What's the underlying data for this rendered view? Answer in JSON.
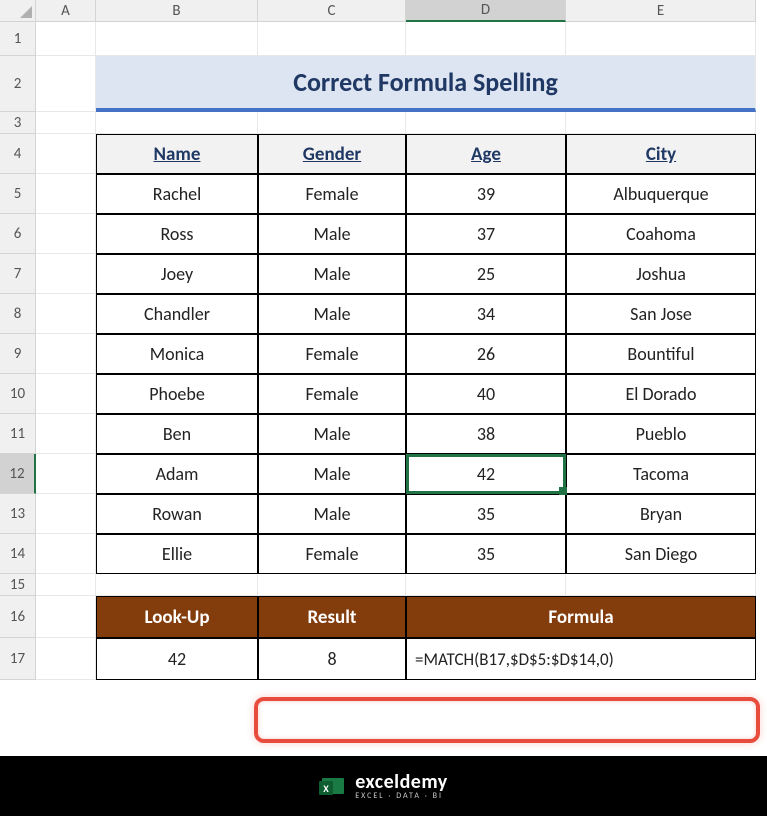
{
  "columns": [
    "A",
    "B",
    "C",
    "D",
    "E"
  ],
  "rows": [
    "1",
    "2",
    "3",
    "4",
    "5",
    "6",
    "7",
    "8",
    "9",
    "10",
    "11",
    "12",
    "13",
    "14",
    "15",
    "16",
    "17"
  ],
  "selected_col": "D",
  "selected_row": "12",
  "title": "Correct Formula Spelling",
  "table": {
    "headers": [
      "Name",
      "Gender",
      "Age",
      "City"
    ],
    "rows": [
      [
        "Rachel",
        "Female",
        "39",
        "Albuquerque"
      ],
      [
        "Ross",
        "Male",
        "37",
        "Coahoma"
      ],
      [
        "Joey",
        "Male",
        "25",
        "Joshua"
      ],
      [
        "Chandler",
        "Male",
        "34",
        "San Jose"
      ],
      [
        "Monica",
        "Female",
        "26",
        "Bountiful"
      ],
      [
        "Phoebe",
        "Female",
        "40",
        "El Dorado"
      ],
      [
        "Ben",
        "Male",
        "38",
        "Pueblo"
      ],
      [
        "Adam",
        "Male",
        "42",
        "Tacoma"
      ],
      [
        "Rowan",
        "Male",
        "35",
        "Bryan"
      ],
      [
        "Ellie",
        "Female",
        "35",
        "San Diego"
      ]
    ]
  },
  "lookup": {
    "headers": [
      "Look-Up",
      "Result",
      "Formula"
    ],
    "value": "42",
    "result": "8",
    "formula": "=MATCH(B17,$D$5:$D$14,0)"
  },
  "brand": {
    "name": "exceldemy",
    "tagline": "EXCEL · DATA · BI"
  },
  "chart_data": {
    "type": "table",
    "title": "Correct Formula Spelling",
    "columns": [
      "Name",
      "Gender",
      "Age",
      "City"
    ],
    "rows": [
      {
        "Name": "Rachel",
        "Gender": "Female",
        "Age": 39,
        "City": "Albuquerque"
      },
      {
        "Name": "Ross",
        "Gender": "Male",
        "Age": 37,
        "City": "Coahoma"
      },
      {
        "Name": "Joey",
        "Gender": "Male",
        "Age": 25,
        "City": "Joshua"
      },
      {
        "Name": "Chandler",
        "Gender": "Male",
        "Age": 34,
        "City": "San Jose"
      },
      {
        "Name": "Monica",
        "Gender": "Female",
        "Age": 26,
        "City": "Bountiful"
      },
      {
        "Name": "Phoebe",
        "Gender": "Female",
        "Age": 40,
        "City": "El Dorado"
      },
      {
        "Name": "Ben",
        "Gender": "Male",
        "Age": 38,
        "City": "Pueblo"
      },
      {
        "Name": "Adam",
        "Gender": "Male",
        "Age": 42,
        "City": "Tacoma"
      },
      {
        "Name": "Rowan",
        "Gender": "Male",
        "Age": 35,
        "City": "Bryan"
      },
      {
        "Name": "Ellie",
        "Gender": "Female",
        "Age": 35,
        "City": "San Diego"
      }
    ],
    "lookup": {
      "value": 42,
      "result": 8,
      "formula": "=MATCH(B17,$D$5:$D$14,0)"
    }
  }
}
